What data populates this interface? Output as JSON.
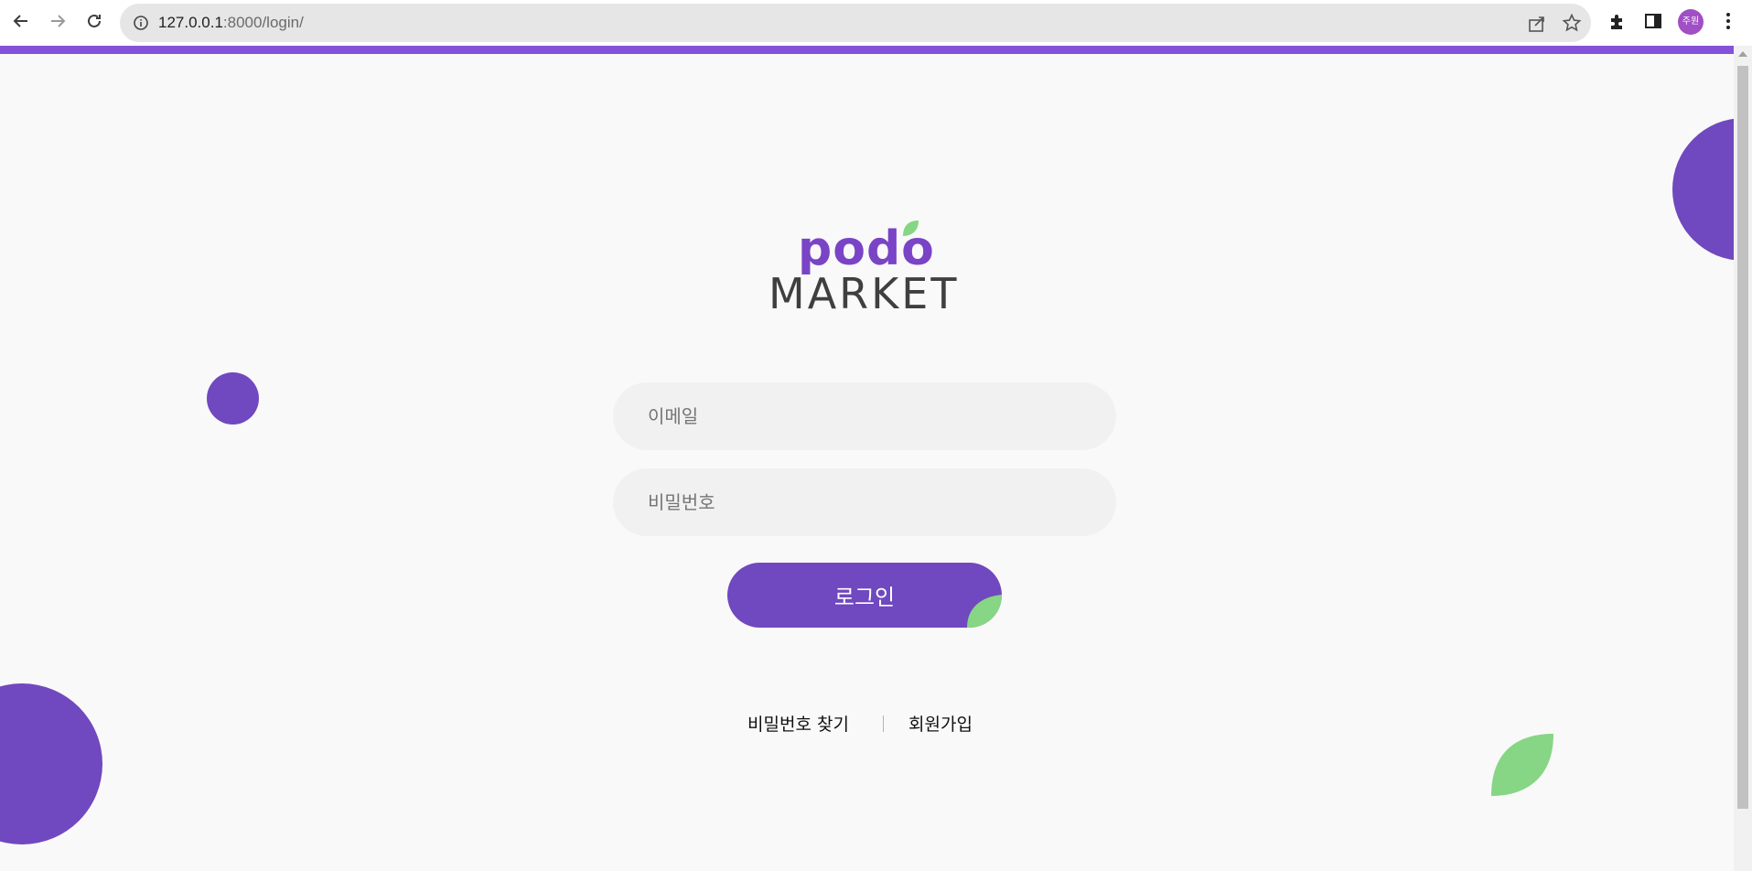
{
  "browser": {
    "url_host": "127.0.0.1",
    "url_path": ":8000/login/",
    "profile_initials": "주원",
    "icons": [
      "back-icon",
      "forward-icon",
      "reload-icon",
      "info-icon",
      "share-icon",
      "star-icon",
      "extensions-icon",
      "side-panel-icon",
      "menu-icon"
    ]
  },
  "logo": {
    "top_text": "podo",
    "bottom_text": "MARKET"
  },
  "login_form": {
    "email_placeholder": "이메일",
    "password_placeholder": "비밀번호",
    "submit_label": "로그인"
  },
  "links": {
    "find_password": "비밀번호 찾기",
    "signup": "회원가입"
  },
  "colors": {
    "brand_purple": "#7048bf",
    "topbar_purple": "#8452d8",
    "leaf_green": "#86d685",
    "background": "#f9f9f9",
    "field_background": "#f1f1f1"
  }
}
